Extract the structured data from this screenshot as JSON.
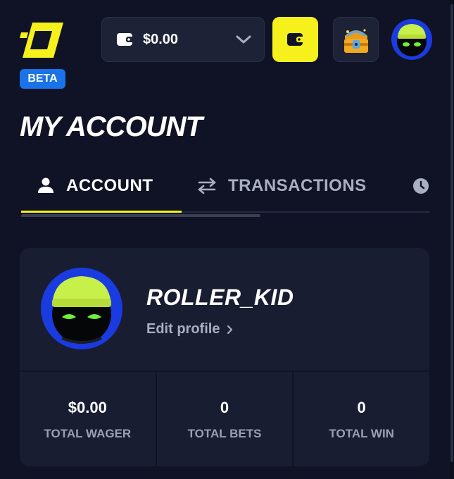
{
  "header": {
    "beta_badge": "BETA",
    "wallet": {
      "balance": "$0.00",
      "icon": "wallet-icon",
      "dropdown_icon": "chevron-down-icon"
    },
    "wallet_button_icon": "wallet-icon",
    "rewards_icon": "treasure-chest-icon",
    "avatar_icon": "avatar-image"
  },
  "page": {
    "title": "MY ACCOUNT"
  },
  "tabs": [
    {
      "label": "ACCOUNT",
      "icon": "user-icon",
      "active": true
    },
    {
      "label": "TRANSACTIONS",
      "icon": "swap-arrows-icon",
      "active": false
    },
    {
      "label": "",
      "icon": "clock-icon",
      "active": false
    }
  ],
  "profile": {
    "username": "ROLLER_KID",
    "edit_label": "Edit profile"
  },
  "stats": [
    {
      "value": "$0.00",
      "label": "TOTAL WAGER"
    },
    {
      "value": "0",
      "label": "TOTAL BETS"
    },
    {
      "value": "0",
      "label": "TOTAL WIN"
    }
  ],
  "colors": {
    "background": "#0f1325",
    "card": "#181d31",
    "accent_yellow": "#f6f01c",
    "beta_blue": "#1a73e8",
    "muted_text": "#a9aec0"
  }
}
